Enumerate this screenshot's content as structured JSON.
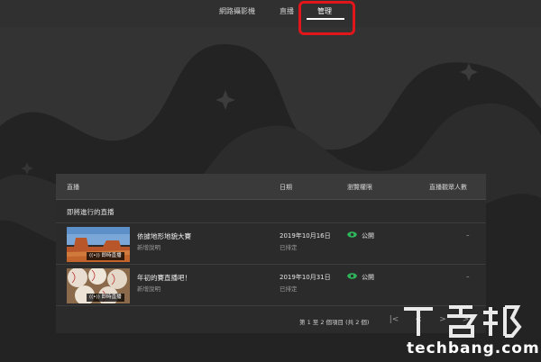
{
  "nav": {
    "tabs": [
      {
        "label": "網路攝影機"
      },
      {
        "label": "直播"
      },
      {
        "label": "管理"
      }
    ]
  },
  "table": {
    "columns": [
      "直播",
      "日期",
      "瀏覽權限",
      "直播觀眾人數"
    ],
    "section_title": "即將進行的直播",
    "rows": [
      {
        "title": "依據地形地貌大賽",
        "subtitle": "新增說明",
        "badge": "((•)) 即時直播",
        "date": "2019年10月16日",
        "date_status": "已排定",
        "visibility": "公開",
        "viewers": "–"
      },
      {
        "title": "年初的賽直播吧！",
        "subtitle": "新增說明",
        "badge": "((•)) 即時直播",
        "date": "2019年10月31日",
        "date_status": "已排定",
        "visibility": "公開",
        "viewers": "–"
      }
    ],
    "pagination_text": "第 1 至 2 個項目 (共 2 個)"
  },
  "watermark": {
    "text": "techbang.com"
  },
  "colors": {
    "background": "#262626",
    "panel": "#2b2b2b",
    "highlight": "#e0161b",
    "visibility_icon": "#2fb35a"
  }
}
